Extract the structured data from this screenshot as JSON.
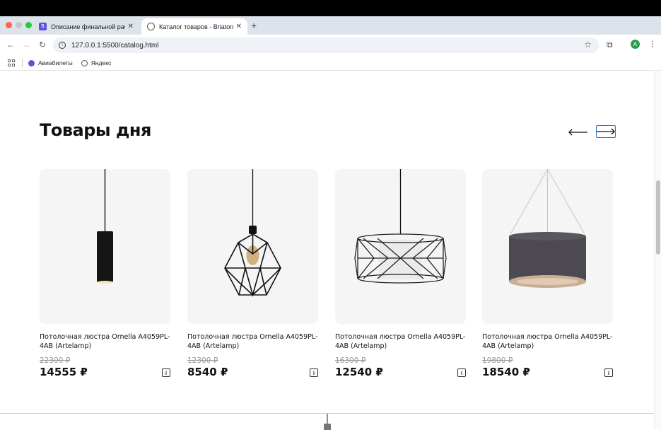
{
  "browser": {
    "tabs": [
      {
        "title": "Описание финальной работы",
        "favicon_letter": "S",
        "favicon_color": "#5b4fe0",
        "active": false
      },
      {
        "title": "Каталог товаров - Briaton",
        "active": true
      }
    ],
    "url": "127.0.0.1:5500/catalog.html",
    "avatar_letter": "A",
    "bookmarks": [
      {
        "label": "Авиабилеты",
        "icon_color": "#7b3fe4"
      },
      {
        "label": "Яндекс",
        "icon_color": "#555555"
      }
    ]
  },
  "section": {
    "title": "Товары дня",
    "nav": {
      "prev": "prev-arrow",
      "next": "next-arrow"
    }
  },
  "products": [
    {
      "name": "Потолочная люстра Ornella A4059PL-4AB (Artelamp)",
      "old_price": "22300 ₽",
      "price": "14555 ₽",
      "image": "cylinder-pendant"
    },
    {
      "name": "Потолочная люстра Ornella A4059PL-4AB (Artelamp)",
      "old_price": "12300 ₽",
      "price": "8540 ₽",
      "image": "geometric-cage-pendant"
    },
    {
      "name": "Потолочная люстра Ornella A4059PL-4AB (Artelamp)",
      "old_price": "16300 ₽",
      "price": "12540 ₽",
      "image": "wire-drum-pendant"
    },
    {
      "name": "Потолочная люстра Ornella A4059PL-4AB (Artelamp)",
      "old_price": "19800 ₽",
      "price": "18540 ₽",
      "image": "fabric-drum-pendant"
    }
  ],
  "colors": {
    "accent": "#2f6fd0",
    "card_bg": "#f5f5f5"
  }
}
